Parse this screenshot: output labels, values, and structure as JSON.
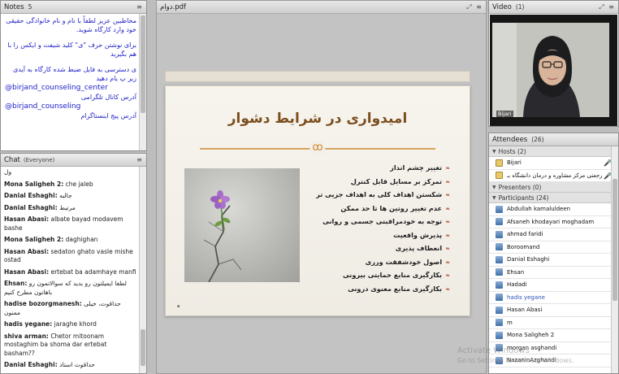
{
  "notes": {
    "title": "Notes",
    "count": "5",
    "lines": [
      {
        "dir": "rtl",
        "text": "مخاطبین عزیز لطفاً با نام و نام خانوادگی حقیقی خود وارد کارگاه شوید."
      },
      {
        "dir": "rtl",
        "text": "برای نوشتن حرف \"ی\" کلید شیفت و ایکس را با هم بگیرید"
      },
      {
        "dir": "rtl",
        "text": "ی دسترسی به فایل ضبط شده کارگاه به آیدی زیر پ یام دهید"
      },
      {
        "dir": "ltr",
        "text": "@birjand_counseling_center"
      },
      {
        "dir": "rtl",
        "text": "آدرس کانال تلگرامی"
      },
      {
        "dir": "ltr",
        "text": "@birjand_counseling"
      },
      {
        "dir": "rtl",
        "text": "آدرس پیج اینستاگرام"
      }
    ]
  },
  "chat": {
    "title": "Chat",
    "scope": "(Everyone)",
    "messages": [
      {
        "name": "",
        "text": "ول"
      },
      {
        "name": "Mona Saligheh 2:",
        "text": "che jaleb"
      },
      {
        "name": "Danial Eshaghi:",
        "text": "جالبه"
      },
      {
        "name": "Danial Eshaghi:",
        "text": "مرتبط"
      },
      {
        "name": "Hasan Abasi:",
        "text": "albate bayad modavem bashe"
      },
      {
        "name": "Mona Saligheh 2:",
        "text": "daghighan"
      },
      {
        "name": "Hasan Abasi:",
        "text": "sedaton ghato vasle mishe ostad"
      },
      {
        "name": "Hasan Abasi:",
        "text": "ertebat ba adamhaye manfi"
      },
      {
        "name": "Ehsan:",
        "text": "لطفا ایمیلتون رو بدید که سوالاتمون رو باهاتون مطرح کنیم"
      },
      {
        "name": "hadise bozorgmanesh:",
        "text": "حداقوت، خیلی ممنون"
      },
      {
        "name": "hadis yegane:",
        "text": "jaraghe khord"
      },
      {
        "name": "shiva arman:",
        "text": "Chetor mitoonam mostaghim ba shoma dar ertebat basham??"
      },
      {
        "name": "Danial Eshaghi:",
        "text": "حداقوت استاد"
      }
    ]
  },
  "document": {
    "title": "دوام.pdf",
    "slide": {
      "heading": "امیدواری در شرایط دشوار",
      "bullets": [
        "تغییر چشم انداز",
        "تمرکز بر مسایل قابل کنترل",
        "شکستن اهداف کلی به اهداف جزیی تر",
        "عدم تغییر روتین ها تا حد ممکن",
        "توجه به خودمراقبتی جسمی و روانی",
        "پذیرش واقعیت",
        "انعطاف پذیری",
        "اصول خودشفقت ورزی",
        "بکارگیری منابع حمایتی بیرونی",
        "بکارگیری منابع معنوی درونی"
      ]
    }
  },
  "video": {
    "title": "Video",
    "count": "(1)",
    "presenter": "Bijari"
  },
  "attendees": {
    "title": "Attendees",
    "count": "(26)",
    "hosts_label": "Hosts (2)",
    "hosts": [
      "Bijari",
      "رجعتی مرکز مشاوره و درمان دانشگاه بـ"
    ],
    "presenters_label": "Presenters (0)",
    "participants_label": "Participants (24)",
    "participants": [
      "Abdullah kamaluldeen",
      "Afsaneh khodayari moghadam",
      "ahmad faridi",
      "Boroomand",
      "Danial Eshaghi",
      "Ehsan",
      "Hadadi",
      "hadis yegane",
      "Hasan Abasi",
      "m",
      "Mona Saligheh 2",
      "morgan asghandi",
      "NazaninAzghandi"
    ]
  },
  "watermark": {
    "line1": "Activate Windows",
    "line2": "Go to Settings to activate Windows."
  },
  "colors": {
    "notes_text": "#1d1dc9",
    "slide_title": "#7c4e1e",
    "bullet": "#b0411e"
  }
}
